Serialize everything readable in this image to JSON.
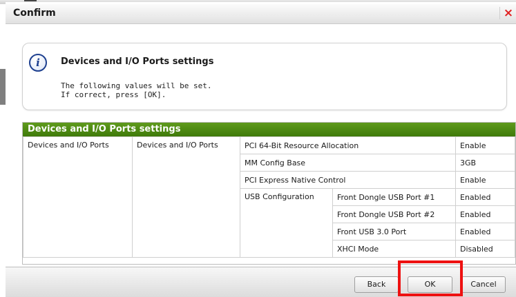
{
  "dialog": {
    "title": "Confirm",
    "close_label": "×"
  },
  "info": {
    "icon": "info-icon",
    "icon_glyph": "i",
    "heading": "Devices and I/O Ports settings",
    "lines": [
      "The following values will be set.",
      "If correct, press [OK]."
    ]
  },
  "section": {
    "header": "Devices and I/O Ports settings",
    "col1": "Devices and I/O Ports",
    "col2": "Devices and I/O Ports",
    "rows": [
      {
        "setting": "PCI 64-Bit Resource Allocation",
        "value": "Enable"
      },
      {
        "setting": "MM Config Base",
        "value": "3GB"
      },
      {
        "setting": "PCI Express Native Control",
        "value": "Enable"
      }
    ],
    "usb": {
      "label": "USB Configuration",
      "items": [
        {
          "setting": "Front Dongle USB Port #1",
          "value": "Enabled"
        },
        {
          "setting": "Front Dongle USB Port #2",
          "value": "Enabled"
        },
        {
          "setting": "Front USB 3.0 Port",
          "value": "Enabled"
        },
        {
          "setting": "XHCI Mode",
          "value": "Disabled"
        }
      ]
    }
  },
  "buttons": {
    "back": "Back",
    "ok": "OK",
    "cancel": "Cancel"
  },
  "colors": {
    "section_header": "#4a8512",
    "close": "#e02020",
    "highlight": "#ee1111"
  }
}
